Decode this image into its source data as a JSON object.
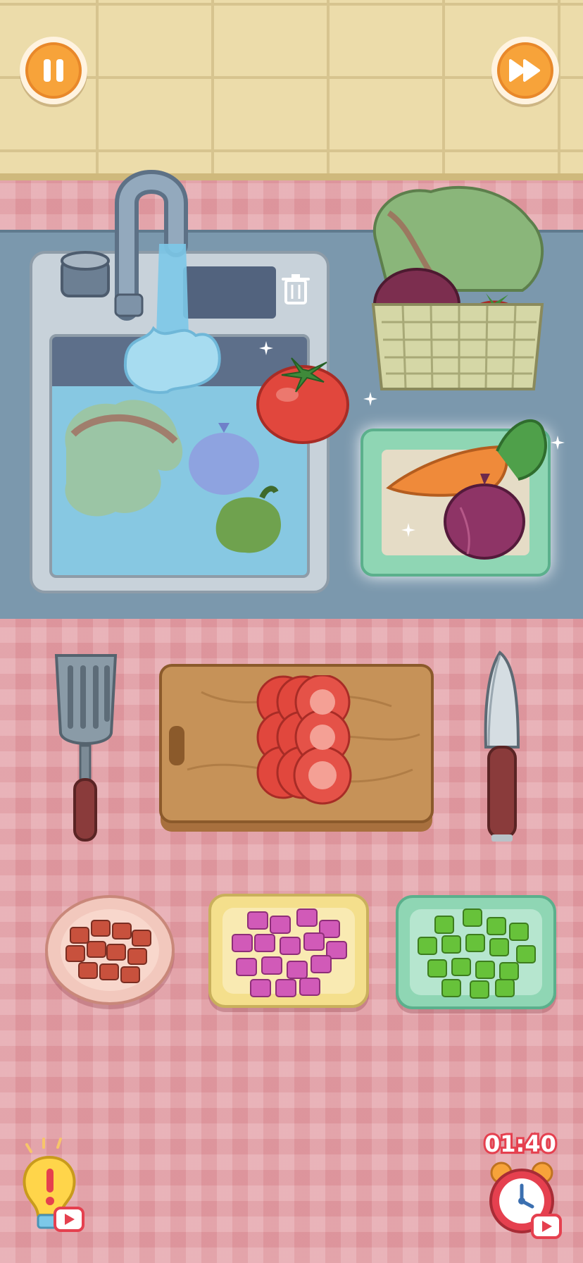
{
  "hud": {
    "timer": "01:40",
    "pause_icon": "pause-icon",
    "fast_forward_icon": "fast-forward-icon",
    "hint_icon": "lightbulb-hint-icon",
    "hint_ad_icon": "video-ad-icon",
    "timer_icon": "alarm-clock-icon",
    "timer_ad_icon": "video-ad-icon"
  },
  "scene": {
    "sink_items": [
      "lettuce",
      "onion",
      "green-pepper"
    ],
    "held_item": "tomato",
    "basket_items": [
      "lettuce",
      "red-onion",
      "tomato"
    ],
    "tray_items": [
      "carrot",
      "red-onion"
    ],
    "cutting_board_items": [
      "sliced-tomato"
    ],
    "tools": [
      "spatula",
      "knife"
    ],
    "bowls": [
      {
        "name": "diced-meat",
        "color": "#c8513d"
      },
      {
        "name": "diced-purple-onion",
        "color": "#d15ab8"
      },
      {
        "name": "diced-green-pepper",
        "color": "#67c23a"
      }
    ]
  },
  "colors": {
    "accent_orange": "#f7a33a",
    "timer_red": "#e5404f",
    "counter": "#7b98ad",
    "tablecloth": "#e4a1a8",
    "wall": "#ecdcaa"
  }
}
